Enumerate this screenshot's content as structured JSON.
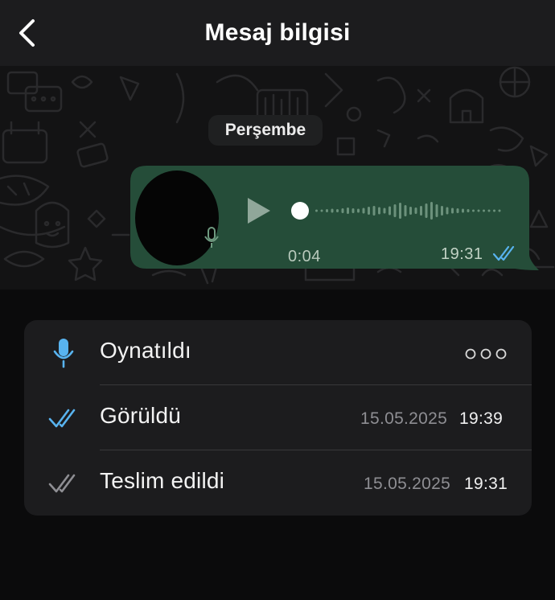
{
  "header": {
    "title": "Mesaj bilgisi",
    "back_icon": "chevron-left-icon"
  },
  "chat": {
    "day_label": "Perşembe",
    "message": {
      "type": "voice",
      "duration": "0:04",
      "time": "19:31",
      "status_icon": "double-check-icon",
      "bubble_color": "#254d39"
    }
  },
  "info": {
    "rows": [
      {
        "icon": "microphone-icon",
        "icon_color": "#58b3ef",
        "label": "Oynatıldı",
        "value": "pending",
        "date": "",
        "time": ""
      },
      {
        "icon": "double-check-icon",
        "icon_color": "#58b3ef",
        "label": "Görüldü",
        "date": "15.05.2025",
        "time": "19:39"
      },
      {
        "icon": "double-check-icon",
        "icon_color": "#8e8e93",
        "label": "Teslim edildi",
        "date": "15.05.2025",
        "time": "19:31"
      }
    ]
  },
  "colors": {
    "accent_blue": "#58b3ef",
    "background": "#0b0b0c",
    "card": "#1c1c1e"
  }
}
